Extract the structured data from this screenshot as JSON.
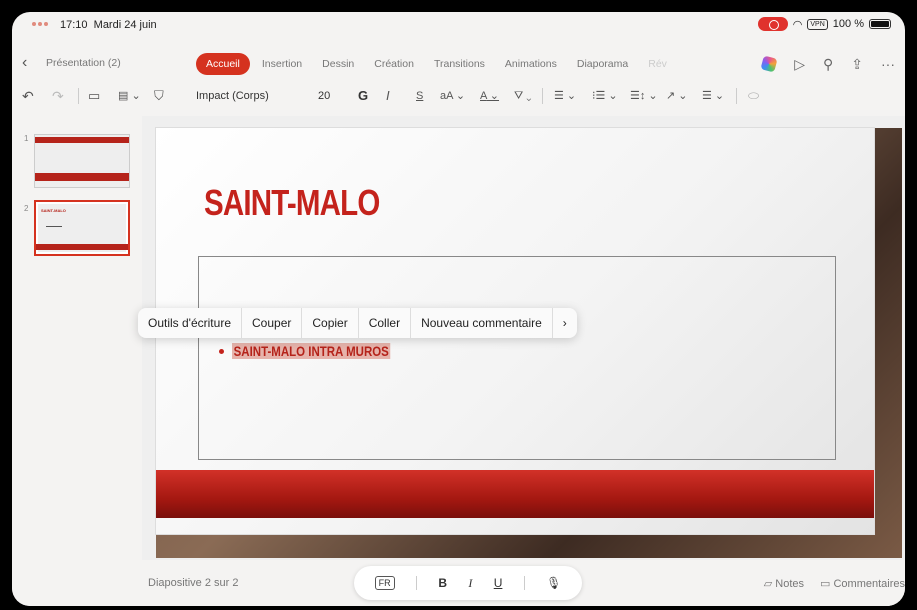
{
  "status_bar": {
    "time": "17:10",
    "date": "Mardi 24 juin",
    "vpn": "VPN",
    "battery": "100 %"
  },
  "tab_bar": {
    "back_icon": "‹",
    "doc_title": "Présentation (2)",
    "tabs": [
      "Accueil",
      "Insertion",
      "Dessin",
      "Création",
      "Transitions",
      "Animations",
      "Diaporama",
      "Rév"
    ],
    "active_tab": "Accueil",
    "icons": [
      "copilot-icon",
      "play-icon",
      "search-icon",
      "share-icon",
      "more-icon"
    ]
  },
  "format_toolbar": {
    "font": "Impact (Corps)",
    "size": "20",
    "bold": "G",
    "italic": "I",
    "strike": "S",
    "font_size_adjust": "aA",
    "font_color": "A"
  },
  "thumbnails": [
    {
      "number": "1"
    },
    {
      "number": "2",
      "title": "SAINT-MALO"
    }
  ],
  "slide": {
    "title": "SAINT-MALO",
    "bullet": "SAINT-MALO INTRA MUROS"
  },
  "context_menu": [
    "Outils d'écriture",
    "Couper",
    "Copier",
    "Coller",
    "Nouveau commentaire",
    "›"
  ],
  "bottom_bar": {
    "slide_count": "Diapositive 2 sur 2",
    "lang": "FR",
    "bold": "B",
    "italic": "I",
    "underline": "U",
    "notes": "Notes",
    "comments": "Commentaires"
  },
  "colors": {
    "accent": "#d5321f",
    "title_red": "#c4231c"
  }
}
